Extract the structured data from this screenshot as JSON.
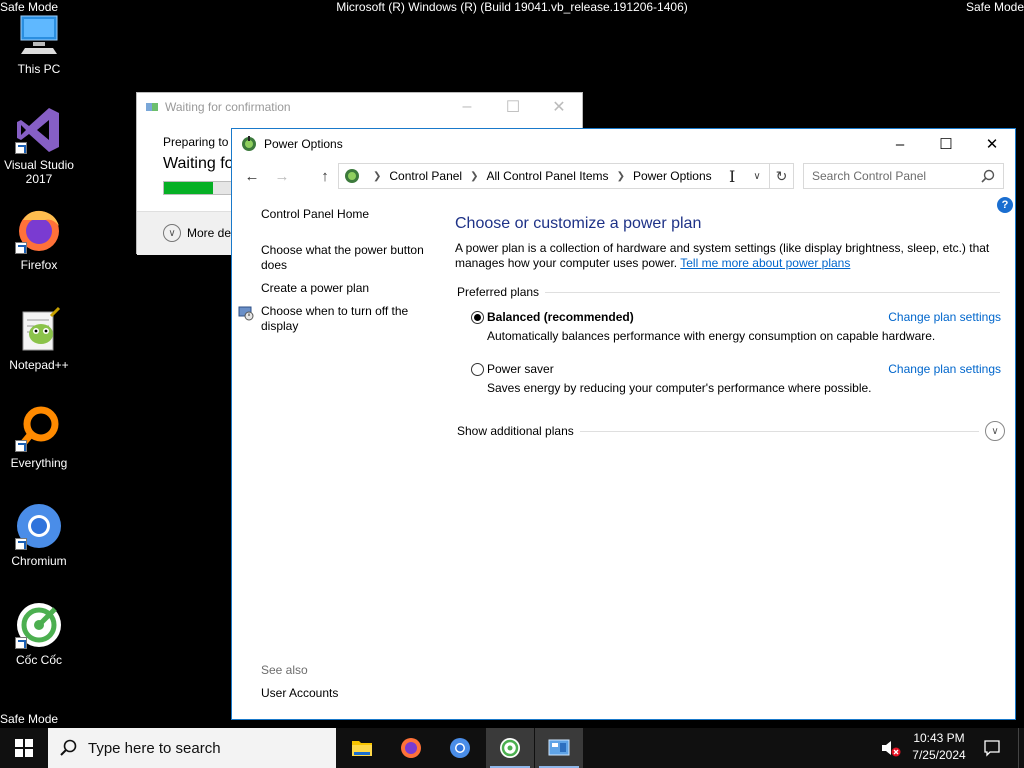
{
  "desktop": {
    "safe_mode": "Safe Mode",
    "build_text": "Microsoft (R) Windows (R) (Build 19041.vb_release.191206-1406)",
    "icons": [
      {
        "label": "This PC",
        "icon": "this-pc-icon"
      },
      {
        "label": "Visual Studio\n2017",
        "icon": "visual-studio-icon"
      },
      {
        "label": "Firefox",
        "icon": "firefox-icon"
      },
      {
        "label": "Notepad++",
        "icon": "notepad-plus-plus-icon"
      },
      {
        "label": "Everything",
        "icon": "everything-icon"
      },
      {
        "label": "Chromium",
        "icon": "chromium-icon"
      },
      {
        "label": "Cốc Cốc",
        "icon": "coc-coc-icon"
      }
    ]
  },
  "wait_dialog": {
    "title": "Waiting for confirmation",
    "preparing": "Preparing to",
    "waiting": "Waiting fo",
    "progress": 0.13,
    "more_details": "More det"
  },
  "window": {
    "title": "Power Options",
    "breadcrumb": [
      "Control Panel",
      "All Control Panel Items",
      "Power Options"
    ],
    "search_placeholder": "Search Control Panel"
  },
  "left_pane": {
    "home": "Control Panel Home",
    "power_button": "Choose what the power button does",
    "create_plan": "Create a power plan",
    "turn_off_display": "Choose when to turn off the display",
    "see_also": "See also",
    "user_accounts": "User Accounts"
  },
  "main": {
    "heading": "Choose or customize a power plan",
    "description": "A power plan is a collection of hardware and system settings (like display brightness, sleep, etc.) that manages how your computer uses power.",
    "learn_more": "Tell me more about power plans",
    "preferred_plans": "Preferred plans",
    "plans": [
      {
        "name": "Balanced (recommended)",
        "selected": true,
        "description": "Automatically balances performance with energy consumption on capable hardware.",
        "change": "Change plan settings"
      },
      {
        "name": "Power saver",
        "selected": false,
        "description": "Saves energy by reducing your computer's performance where possible.",
        "change": "Change plan settings"
      }
    ],
    "show_additional": "Show additional plans"
  },
  "taskbar": {
    "search_placeholder": "Type here to search",
    "time": "10:43 PM",
    "date": "7/25/2024"
  },
  "colors": {
    "accent_blue": "#1979ca",
    "heading_blue": "#1e3287",
    "link_blue": "#0066cc",
    "progress_green": "#06b025"
  }
}
